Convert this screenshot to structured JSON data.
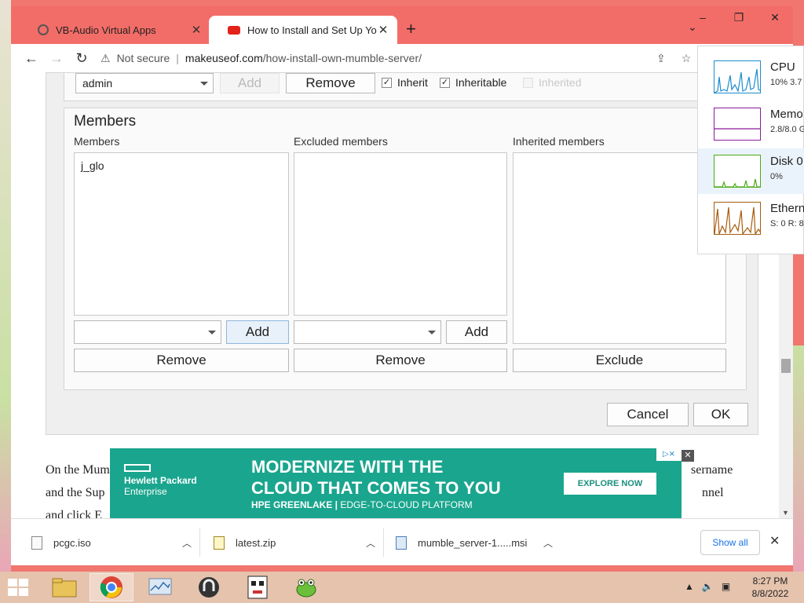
{
  "tabs": [
    {
      "title": "VB-Audio Virtual Apps",
      "active": false,
      "favicon_color": "#666666"
    },
    {
      "title": "How to Install and Set Up Your O",
      "active": true,
      "favicon_color": "#e2231a"
    }
  ],
  "toolbar": {
    "security_label": "Not secure",
    "url_domain": "makeuseof.com",
    "url_path": "/how-install-own-mumble-server/"
  },
  "top_row": {
    "group_value": "admin",
    "add_label": "Add",
    "remove_label": "Remove",
    "inherit_label": "Inherit",
    "inheritable_label": "Inheritable",
    "inherited_label": "Inherited"
  },
  "members_dialog": {
    "group_title": "Members",
    "columns": [
      {
        "label": "Members",
        "items": [
          "j_glo"
        ],
        "add_label": "Add",
        "remove_label": "Remove"
      },
      {
        "label": "Excluded members",
        "items": [],
        "add_label": "Add",
        "remove_label": "Remove"
      },
      {
        "label": "Inherited members",
        "items": [],
        "exclude_label": "Exclude"
      }
    ],
    "cancel_label": "Cancel",
    "ok_label": "OK"
  },
  "article_lines": [
    "On the Mum",
    "and the Sup",
    "and click E",
    "sername",
    "nnel"
  ],
  "ad": {
    "brand_line1": "Hewlett Packard",
    "brand_line2": "Enterprise",
    "headline1": "MODERNIZE WITH THE",
    "headline2": "CLOUD THAT COMES TO YOU",
    "sub_bold": "HPE GREENLAKE |",
    "sub_light": " EDGE-TO-CLOUD PLATFORM",
    "cta": "EXPLORE NOW"
  },
  "downloads": [
    {
      "name": "pcgc.iso"
    },
    {
      "name": "latest.zip"
    },
    {
      "name": "mumble_server-1.....msi"
    }
  ],
  "show_all_label": "Show all",
  "resource_monitor": [
    {
      "name": "CPU",
      "value": "10% 3.7",
      "color": "#1d8ccd"
    },
    {
      "name": "Memo",
      "value": "2.8/8.0 G",
      "color": "#8b1a9b"
    },
    {
      "name": "Disk 0",
      "value": "0%",
      "color": "#4caa14"
    },
    {
      "name": "Ethern",
      "value": "S: 0 R: 8",
      "color": "#a75b0d"
    }
  ],
  "clock": {
    "time": "8:27 PM",
    "date": "8/8/2022"
  },
  "colors": {
    "titlebar": "#f36d68",
    "taskbar": "#e6c3ad",
    "ad_bg": "#1aa58e"
  }
}
